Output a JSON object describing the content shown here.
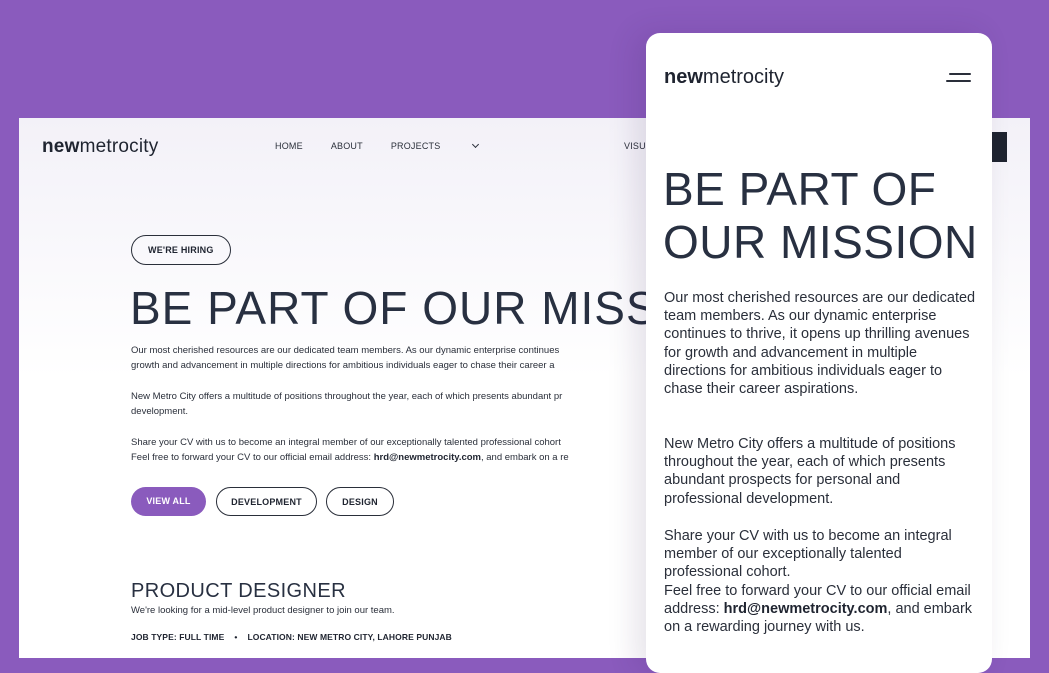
{
  "desktop": {
    "logo": {
      "bold": "new",
      "light": "metrocity"
    },
    "nav": {
      "home": "HOME",
      "about": "ABOUT",
      "projects": "PROJECTS",
      "visual_partial": "VISU"
    },
    "hiring_badge": "WE'RE HIRING",
    "title": "BE PART OF OUR MISSION",
    "para1_line1": "Our most cherished resources are our dedicated team members. As our dynamic enterprise continues",
    "para1_line2": "growth and advancement in multiple directions for ambitious individuals eager to chase their career a",
    "para2_line1": "New Metro City offers a multitude of positions throughout the year, each of which presents abundant pr",
    "para2_line2": "development.",
    "para3_line1": "Share your CV with us to become an integral member of our exceptionally talented professional cohort",
    "para3_line2_prefix": "Feel free to forward your CV to our official email address: ",
    "email": "hrd@newmetrocity.com",
    "para3_line2_suffix": ", and embark on a re",
    "filters": {
      "view_all": "VIEW ALL",
      "development": "DEVELOPMENT",
      "design": "DESIGN"
    },
    "job": {
      "title": "PRODUCT DESIGNER",
      "description": "We're looking for a mid-level product designer to join our team.",
      "type": "JOB TYPE: FULL TIME",
      "separator": "•",
      "location": "LOCATION: NEW METRO CITY, LAHORE PUNJAB"
    }
  },
  "mobile": {
    "logo": {
      "bold": "new",
      "light": "metrocity"
    },
    "title_line1": "BE PART OF",
    "title_line2": "OUR MISSION",
    "para1": "Our most cherished resources are our dedicated team members. As our dynamic enterprise continues to thrive, it opens up thrilling avenues for growth and advancement in multiple directions for ambitious individuals eager to chase their career aspirations.",
    "para2": "New Metro City offers a multitude of positions throughout the year, each of which presents abundant prospects for personal and professional development.",
    "para3": "Share your CV with us to become an integral member of our exceptionally talented professional cohort.",
    "para4_prefix": "Feel free to forward your CV to our official email address: ",
    "email": "hrd@newmetrocity.com",
    "para4_suffix": ", and embark on a rewarding journey with us."
  },
  "colors": {
    "background": "#8a5bbd",
    "accent": "#8a5bbd",
    "ink": "#283041"
  }
}
